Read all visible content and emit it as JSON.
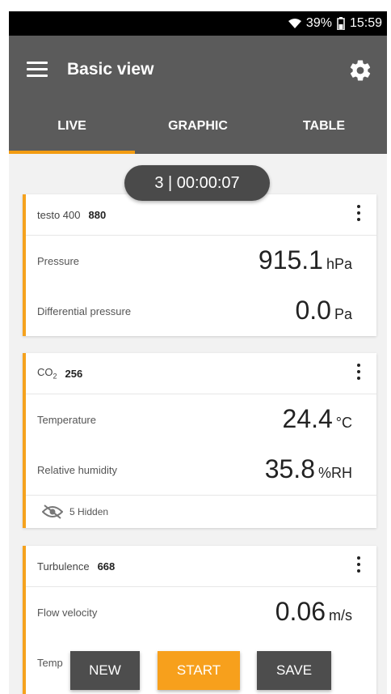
{
  "status": {
    "battery": "39%",
    "time": "15:59"
  },
  "header": {
    "title": "Basic view"
  },
  "tabs": [
    {
      "label": "LIVE",
      "active": true
    },
    {
      "label": "GRAPHIC",
      "active": false
    },
    {
      "label": "TABLE",
      "active": false
    }
  ],
  "timer": "3 | 00:00:07",
  "cards": [
    {
      "device": "testo 400",
      "serial": "880",
      "rows": [
        {
          "label": "Pressure",
          "value": "915.1",
          "unit": "hPa"
        },
        {
          "label": "Differential pressure",
          "value": "0.0",
          "unit": "Pa"
        }
      ]
    },
    {
      "device": "CO",
      "device_sub": "2",
      "serial": "256",
      "rows": [
        {
          "label": "Temperature",
          "value": "24.4",
          "unit": "°C"
        },
        {
          "label": "Relative humidity",
          "value": "35.8",
          "unit": "%RH"
        }
      ],
      "hidden_text": "5 Hidden"
    },
    {
      "device": "Turbulence",
      "serial": "668",
      "rows": [
        {
          "label": "Flow velocity",
          "value": "0.06",
          "unit": "m/s"
        },
        {
          "label": "Temp",
          "value": "",
          "unit": ""
        }
      ]
    }
  ],
  "actions": {
    "new": "NEW",
    "start": "START",
    "save": "SAVE"
  },
  "colors": {
    "accent": "#f39c12",
    "appbar": "#5b5b5b",
    "card_border": "#f5a21e",
    "button_dark": "#4d4d4d"
  }
}
